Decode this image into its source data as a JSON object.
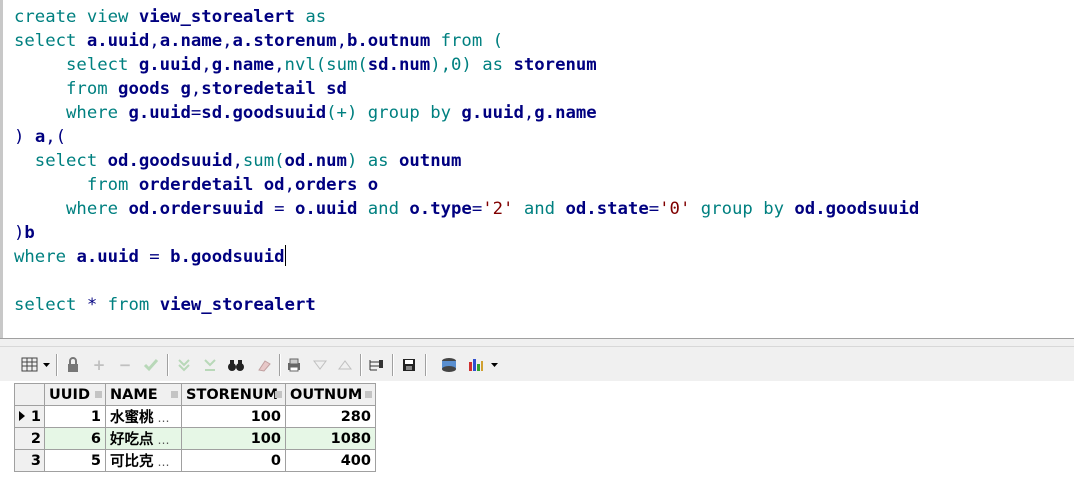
{
  "editor": {
    "lines": [
      [
        [
          "kw",
          "create view "
        ],
        [
          "id",
          "view_storealert"
        ],
        [
          "kw",
          " as"
        ]
      ],
      [
        [
          "kw",
          "select "
        ],
        [
          "id",
          "a.uuid"
        ],
        [
          "op",
          ","
        ],
        [
          "id",
          "a.name"
        ],
        [
          "op",
          ","
        ],
        [
          "id",
          "a.storenum"
        ],
        [
          "op",
          ","
        ],
        [
          "id",
          "b.outnum"
        ],
        [
          "kw",
          " from ("
        ]
      ],
      [
        [
          "kw",
          "     select "
        ],
        [
          "id",
          "g.uuid"
        ],
        [
          "op",
          ","
        ],
        [
          "id",
          "g.name"
        ],
        [
          "op",
          ","
        ],
        [
          "kw",
          "nvl(sum("
        ],
        [
          "id",
          "sd.num"
        ],
        [
          "kw",
          "),0) as "
        ],
        [
          "id",
          "storenum"
        ]
      ],
      [
        [
          "kw",
          "     from "
        ],
        [
          "id",
          "goods g"
        ],
        [
          "op",
          ","
        ],
        [
          "id",
          "storedetail sd"
        ]
      ],
      [
        [
          "kw",
          "     where "
        ],
        [
          "id",
          "g.uuid"
        ],
        [
          "op",
          "="
        ],
        [
          "id",
          "sd.goodsuuid"
        ],
        [
          "kw",
          "(+) group by "
        ],
        [
          "id",
          "g.uuid"
        ],
        [
          "op",
          ","
        ],
        [
          "id",
          "g.name"
        ]
      ],
      [
        [
          "op",
          ") "
        ],
        [
          "id",
          "a"
        ],
        [
          "op",
          ",("
        ]
      ],
      [
        [
          "kw",
          "  select "
        ],
        [
          "id",
          "od.goodsuuid"
        ],
        [
          "op",
          ","
        ],
        [
          "kw",
          "sum("
        ],
        [
          "id",
          "od.num"
        ],
        [
          "kw",
          ") as "
        ],
        [
          "id",
          "outnum"
        ]
      ],
      [
        [
          "kw",
          "       from "
        ],
        [
          "id",
          "orderdetail od"
        ],
        [
          "op",
          ","
        ],
        [
          "id",
          "orders o"
        ]
      ],
      [
        [
          "kw",
          "     where "
        ],
        [
          "id",
          "od.ordersuuid"
        ],
        [
          "op",
          " = "
        ],
        [
          "id",
          "o.uuid"
        ],
        [
          "kw",
          " and "
        ],
        [
          "id",
          "o.type"
        ],
        [
          "op",
          "="
        ],
        [
          "str",
          "'2'"
        ],
        [
          "kw",
          " and "
        ],
        [
          "id",
          "od.state"
        ],
        [
          "op",
          "="
        ],
        [
          "str",
          "'0'"
        ],
        [
          "kw",
          " group by "
        ],
        [
          "id",
          "od.goodsuuid"
        ]
      ],
      [
        [
          "op",
          ")"
        ],
        [
          "id",
          "b"
        ]
      ],
      [
        [
          "kw",
          "where "
        ],
        [
          "id",
          "a.uuid"
        ],
        [
          "op",
          " = "
        ],
        [
          "id",
          "b.goodsuuid"
        ],
        [
          "caret",
          ""
        ]
      ],
      [],
      [
        [
          "kw",
          "select "
        ],
        [
          "op",
          "* "
        ],
        [
          "kw",
          "from "
        ],
        [
          "id",
          "view_storealert"
        ]
      ]
    ]
  },
  "toolbar": {
    "icons": [
      "grid-select-icon",
      "dropdown-arrow-icon",
      "lock-icon",
      "plus-icon",
      "minus-icon",
      "check-icon",
      "down-arrow-icon",
      "down-arrow-double-icon",
      "binoculars-icon",
      "eraser-icon",
      "print-icon",
      "triangle-down-icon",
      "triangle-up-icon",
      "tree-export-icon",
      "save-icon",
      "query-by-example-icon",
      "chart-icon",
      "dropdown-arrow-icon-2"
    ]
  },
  "grid": {
    "columns": [
      "UUID",
      "NAME",
      "STORENUM",
      "OUTNUM"
    ],
    "rows": [
      {
        "n": "1",
        "uuid": "1",
        "name": "水蜜桃",
        "storenum": "100",
        "outnum": "280"
      },
      {
        "n": "2",
        "uuid": "6",
        "name": "好吃点",
        "storenum": "100",
        "outnum": "1080"
      },
      {
        "n": "3",
        "uuid": "5",
        "name": "可比克",
        "storenum": "0",
        "outnum": "400"
      }
    ],
    "ellipsis": "…"
  },
  "colors": {
    "keyword": "#008080",
    "identifier": "#000080",
    "string": "#800000",
    "alt_row": "#e6f7e6"
  }
}
